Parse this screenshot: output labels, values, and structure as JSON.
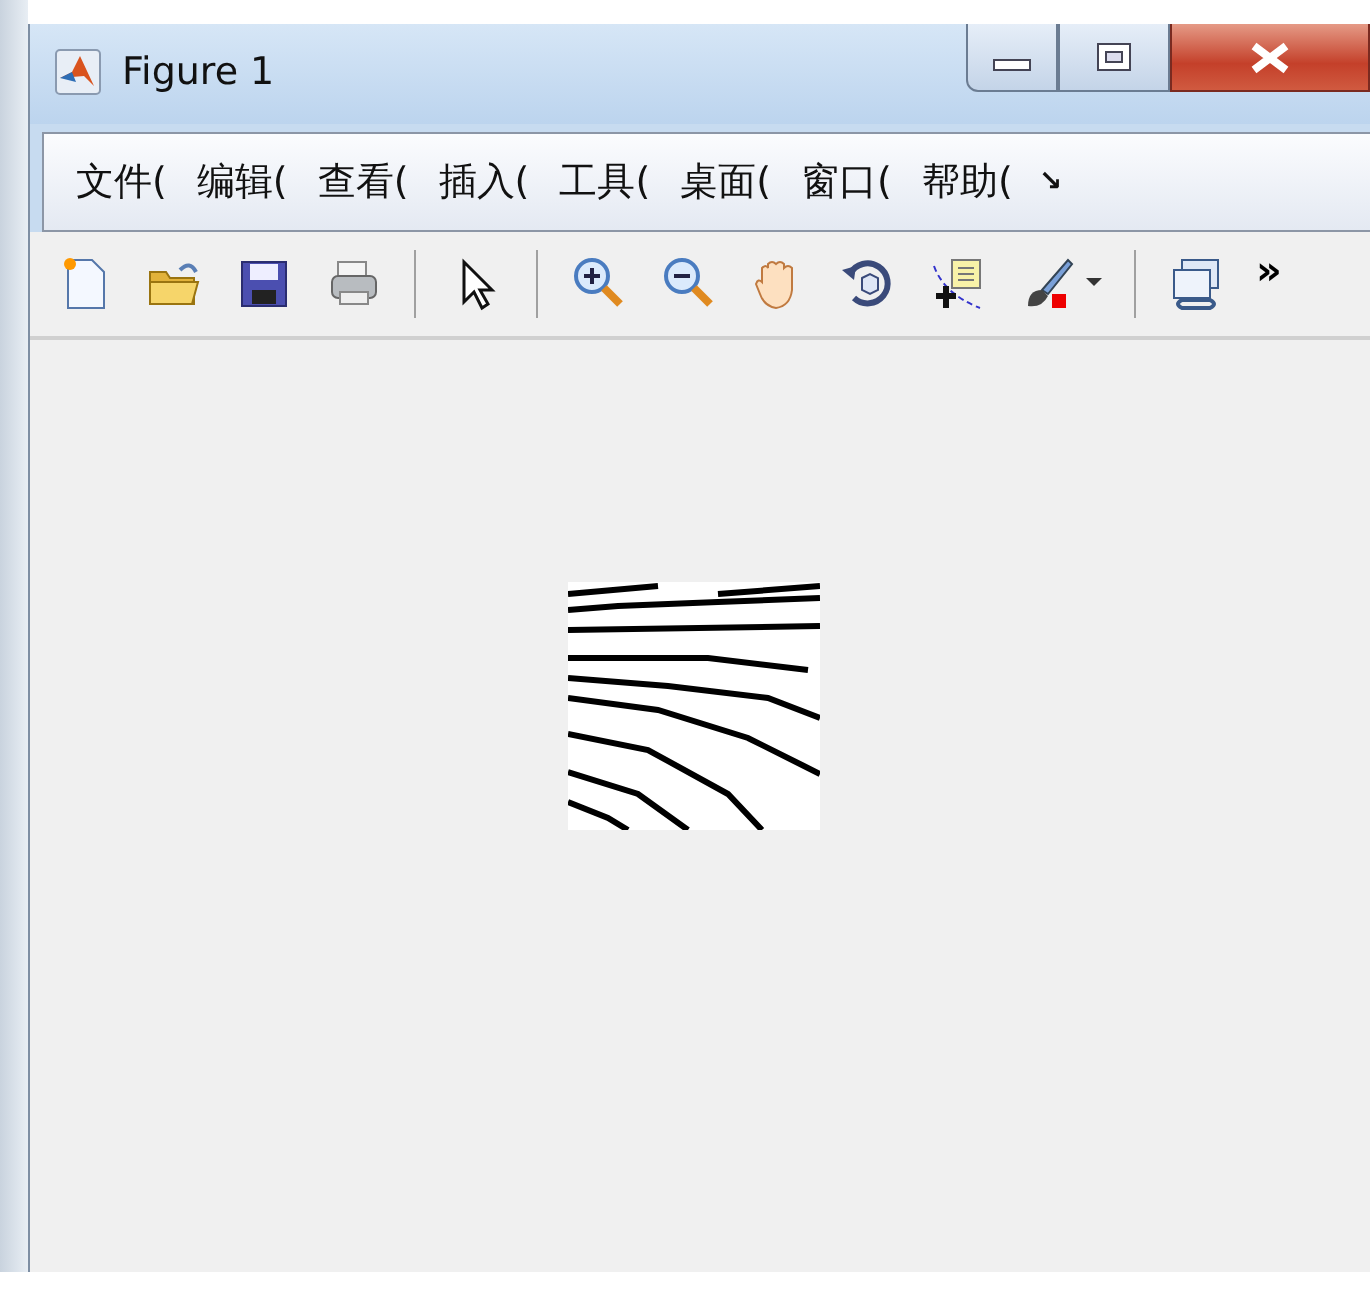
{
  "window": {
    "title": "Figure 1"
  },
  "menu": [
    {
      "label": "文件("
    },
    {
      "label": "编辑("
    },
    {
      "label": "查看("
    },
    {
      "label": "插入("
    },
    {
      "label": "工具("
    },
    {
      "label": "桌面("
    },
    {
      "label": "窗口("
    },
    {
      "label": "帮助("
    }
  ],
  "menu_overflow": "↘",
  "toolbar": [
    {
      "kind": "new"
    },
    {
      "kind": "open"
    },
    {
      "kind": "save"
    },
    {
      "kind": "print"
    },
    {
      "kind": "sep"
    },
    {
      "kind": "pointer"
    },
    {
      "kind": "sep"
    },
    {
      "kind": "zoomin"
    },
    {
      "kind": "zoomout"
    },
    {
      "kind": "pan"
    },
    {
      "kind": "rotate"
    },
    {
      "kind": "cursor"
    },
    {
      "kind": "brush"
    },
    {
      "kind": "dropdown"
    },
    {
      "kind": "sep"
    },
    {
      "kind": "link"
    }
  ],
  "toolbar_overflow": "»"
}
